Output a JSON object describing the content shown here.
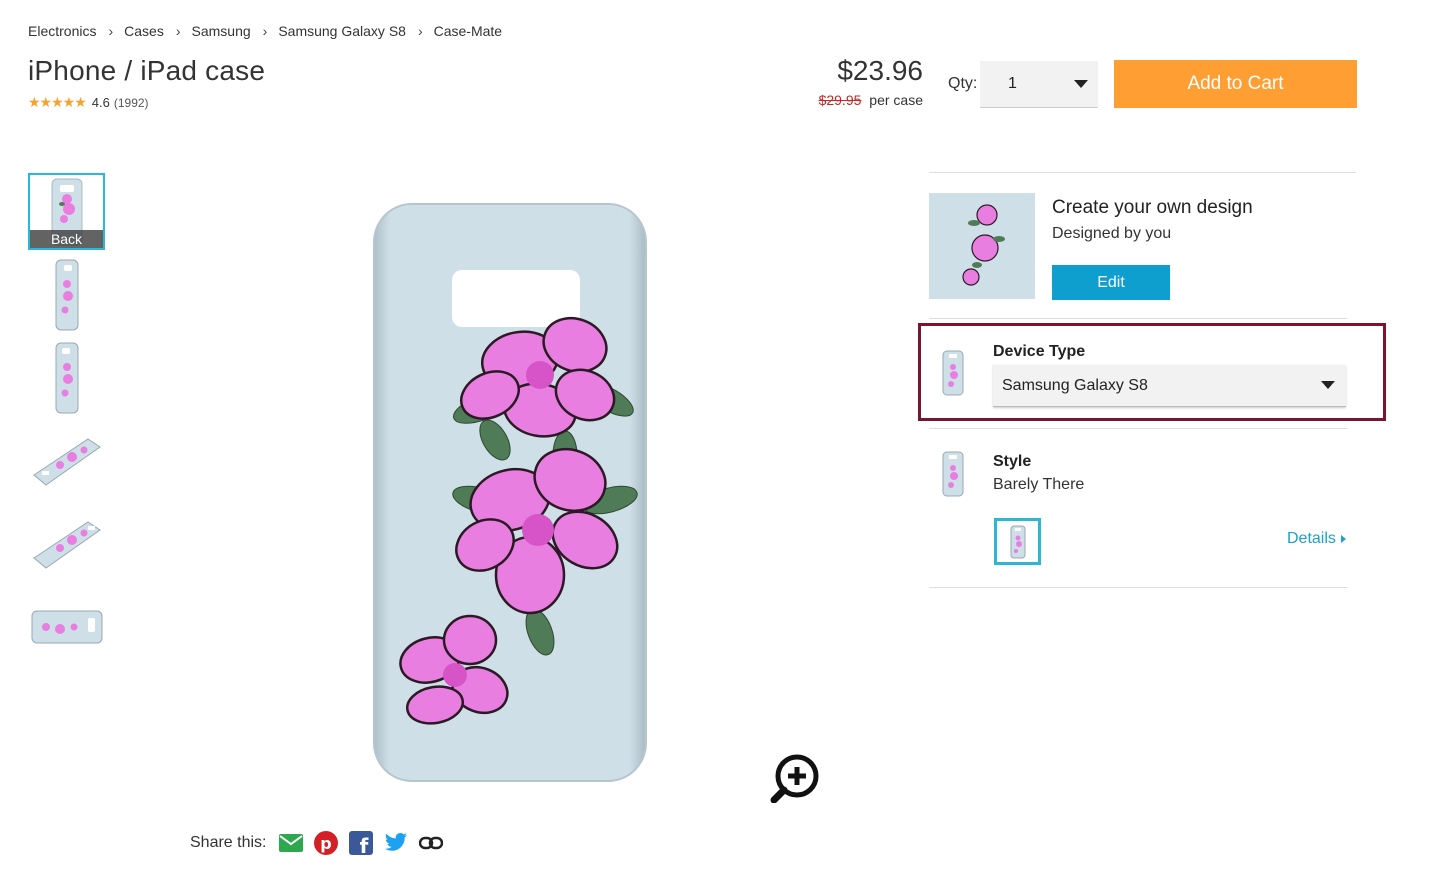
{
  "breadcrumb": [
    "Electronics",
    "Cases",
    "Samsung",
    "Samsung Galaxy S8",
    "Case-Mate"
  ],
  "product": {
    "title": "iPhone / iPad case",
    "rating": "4.6",
    "review_count": "(1992)",
    "star_rating": 4.6,
    "price": "$23.96",
    "old_price": "$29.95",
    "price_unit": "per case"
  },
  "purchase": {
    "qty_label": "Qty:",
    "qty_value": "1",
    "add_to_cart_label": "Add to Cart"
  },
  "thumbnails": [
    {
      "name": "back",
      "label": "Back",
      "selected": true
    },
    {
      "name": "side-right",
      "label": "",
      "selected": false
    },
    {
      "name": "side-left",
      "label": "",
      "selected": false
    },
    {
      "name": "angled-1",
      "label": "",
      "selected": false
    },
    {
      "name": "angled-2",
      "label": "",
      "selected": false
    },
    {
      "name": "flat",
      "label": "",
      "selected": false
    }
  ],
  "share": {
    "label": "Share this:",
    "icons": [
      "email-icon",
      "pinterest-icon",
      "facebook-icon",
      "twitter-icon",
      "link-icon"
    ]
  },
  "design": {
    "title": "Create your own design",
    "subtitle": "Designed by you",
    "edit_label": "Edit"
  },
  "device": {
    "label": "Device Type",
    "value": "Samsung Galaxy S8"
  },
  "style": {
    "label": "Style",
    "value": "Barely There",
    "details_label": "Details"
  },
  "colors": {
    "accent_orange": "#ff9e32",
    "accent_blue": "#0e9fcf",
    "highlight_border": "#7a1430",
    "case_color": "#cfdfe8",
    "flower_pink": "#e87ee0",
    "old_price_red": "#c62828"
  }
}
